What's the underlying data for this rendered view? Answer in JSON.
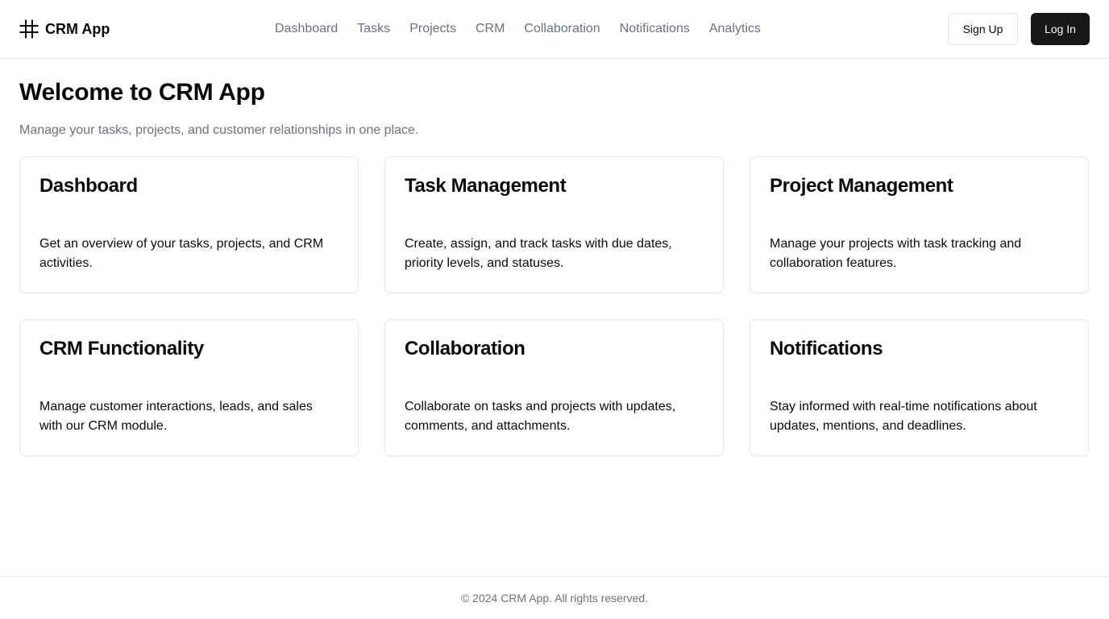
{
  "header": {
    "brand_name": "CRM App",
    "brand_icon": "hash-icon",
    "nav": [
      {
        "label": "Dashboard"
      },
      {
        "label": "Tasks"
      },
      {
        "label": "Projects"
      },
      {
        "label": "CRM"
      },
      {
        "label": "Collaboration"
      },
      {
        "label": "Notifications"
      },
      {
        "label": "Analytics"
      }
    ],
    "signup_label": "Sign Up",
    "login_label": "Log In"
  },
  "main": {
    "title": "Welcome to CRM App",
    "subtitle": "Manage your tasks, projects, and customer relationships in one place.",
    "cards": [
      {
        "title": "Dashboard",
        "description": "Get an overview of your tasks, projects, and CRM activities."
      },
      {
        "title": "Task Management",
        "description": "Create, assign, and track tasks with due dates, priority levels, and statuses."
      },
      {
        "title": "Project Management",
        "description": "Manage your projects with task tracking and collaboration features."
      },
      {
        "title": "CRM Functionality",
        "description": "Manage customer interactions, leads, and sales with our CRM module."
      },
      {
        "title": "Collaboration",
        "description": "Collaborate on tasks and projects with updates, comments, and attachments."
      },
      {
        "title": "Notifications",
        "description": "Stay informed with real-time notifications about updates, mentions, and deadlines."
      }
    ]
  },
  "footer": {
    "text": "© 2024 CRM App. All rights reserved."
  },
  "colors": {
    "text": "#0a0a0a",
    "muted": "#6b7280",
    "border": "#e5e7eb",
    "primary_button": "#171717"
  }
}
